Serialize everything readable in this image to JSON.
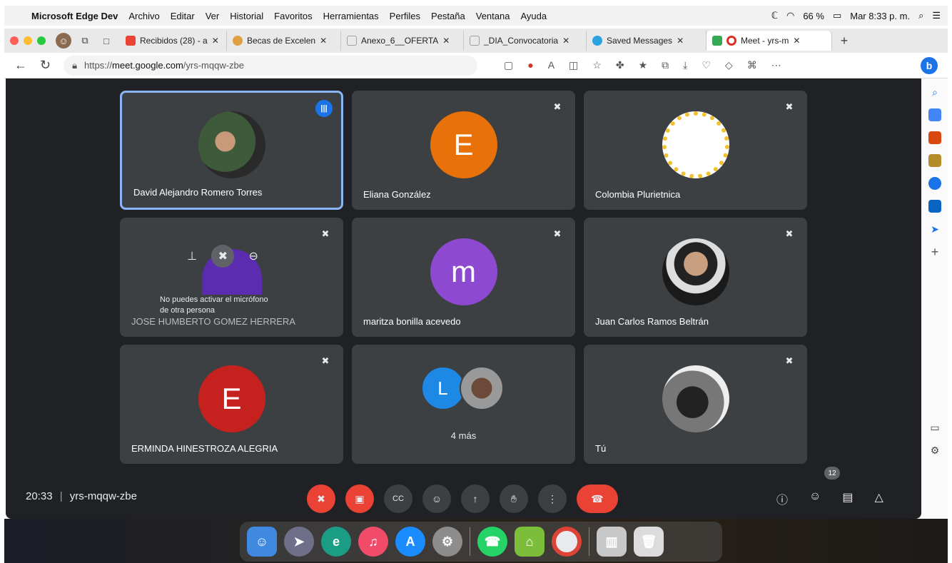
{
  "menubar": {
    "app_name": "Microsoft Edge Dev",
    "items": [
      "Archivo",
      "Editar",
      "Ver",
      "Historial",
      "Favoritos",
      "Herramientas",
      "Perfiles",
      "Pestaña",
      "Ventana",
      "Ayuda"
    ],
    "battery": "66 %",
    "clock": "Mar 8:33 p. m."
  },
  "tabs": [
    {
      "label": "Recibidos (28) - a",
      "favicon_color": "#ea4335"
    },
    {
      "label": "Becas de Excelen",
      "favicon_color": "#e0a040"
    },
    {
      "label": "Anexo_6__OFERTA",
      "favicon_color": "#9aa0a6"
    },
    {
      "label": "_DIA_Convocatoria",
      "favicon_color": "#9aa0a6"
    },
    {
      "label": "Saved Messages",
      "favicon_color": "#2aa3e0"
    },
    {
      "label": "Meet - yrs-m",
      "favicon_color": "#34a853"
    }
  ],
  "address": {
    "prefix": "https://",
    "host": "meet.google.com",
    "path": "/yrs-mqqw-zbe"
  },
  "participants": [
    {
      "name": "David Alejandro Romero Torres",
      "type": "photo",
      "speaking": true,
      "color": "#6b7b5a"
    },
    {
      "name": "Eliana González",
      "type": "letter",
      "letter": "E",
      "color": "#e8710a"
    },
    {
      "name": "Colombia Plurietnica",
      "type": "logo",
      "color": "#ffffff"
    },
    {
      "name": "JOSE HUMBERTO GOMEZ HERRERA",
      "type": "hover",
      "color": "#5b2bb0"
    },
    {
      "name": "maritza bonilla acevedo",
      "type": "letter",
      "letter": "m",
      "color": "#8e49d1"
    },
    {
      "name": "Juan Carlos Ramos Beltrán",
      "type": "photo",
      "color": "#d9d9d9"
    },
    {
      "name": "ERMINDA HINESTROZA ALEGRIA",
      "type": "letter",
      "letter": "E",
      "color": "#c5221f"
    },
    {
      "name": "",
      "type": "more",
      "letter": "L",
      "more_label": "4 más",
      "color": "#1e88e5"
    },
    {
      "name": "Tú",
      "type": "photo",
      "color": "#555555"
    }
  ],
  "hover_tooltip": {
    "line1": "No puedes activar el micrófono",
    "line2": "de otra persona"
  },
  "bottombar": {
    "time": "20:33",
    "separator": "|",
    "meeting_code": "yrs-mqqw-zbe",
    "participants_count": "12"
  }
}
